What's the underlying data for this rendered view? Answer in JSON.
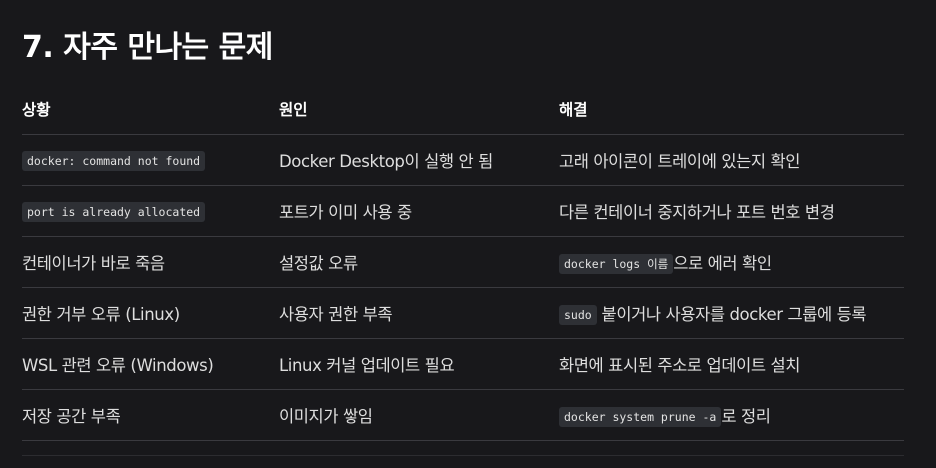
{
  "heading": "7. 자주 만나는 문제",
  "table": {
    "headers": [
      "상황",
      "원인",
      "해결"
    ],
    "rows": [
      {
        "situation": "",
        "situation_code": "docker: command not found",
        "cause": "Docker Desktop이 실행 안 됨",
        "fix_code": "",
        "fix": "고래 아이콘이 트레이에 있는지 확인"
      },
      {
        "situation": "",
        "situation_code": "port is already allocated",
        "cause": "포트가 이미 사용 중",
        "fix_code": "",
        "fix": "다른 컨테이너 중지하거나 포트 번호 변경"
      },
      {
        "situation": "컨테이너가 바로 죽음",
        "situation_code": "",
        "cause": "설정값 오류",
        "fix_code": "docker logs 이름",
        "fix": "으로 에러 확인"
      },
      {
        "situation": "권한 거부 오류 (Linux)",
        "situation_code": "",
        "cause": "사용자 권한 부족",
        "fix_code": "sudo",
        "fix": " 붙이거나 사용자를 docker 그룹에 등록"
      },
      {
        "situation": "WSL 관련 오류 (Windows)",
        "situation_code": "",
        "cause": "Linux 커널 업데이트 필요",
        "fix_code": "",
        "fix": "화면에 표시된 주소로 업데이트 설치"
      },
      {
        "situation": "저장 공간 부족",
        "situation_code": "",
        "cause": "이미지가 쌓임",
        "fix_code": "docker system prune -a",
        "fix": "로 정리"
      }
    ]
  }
}
